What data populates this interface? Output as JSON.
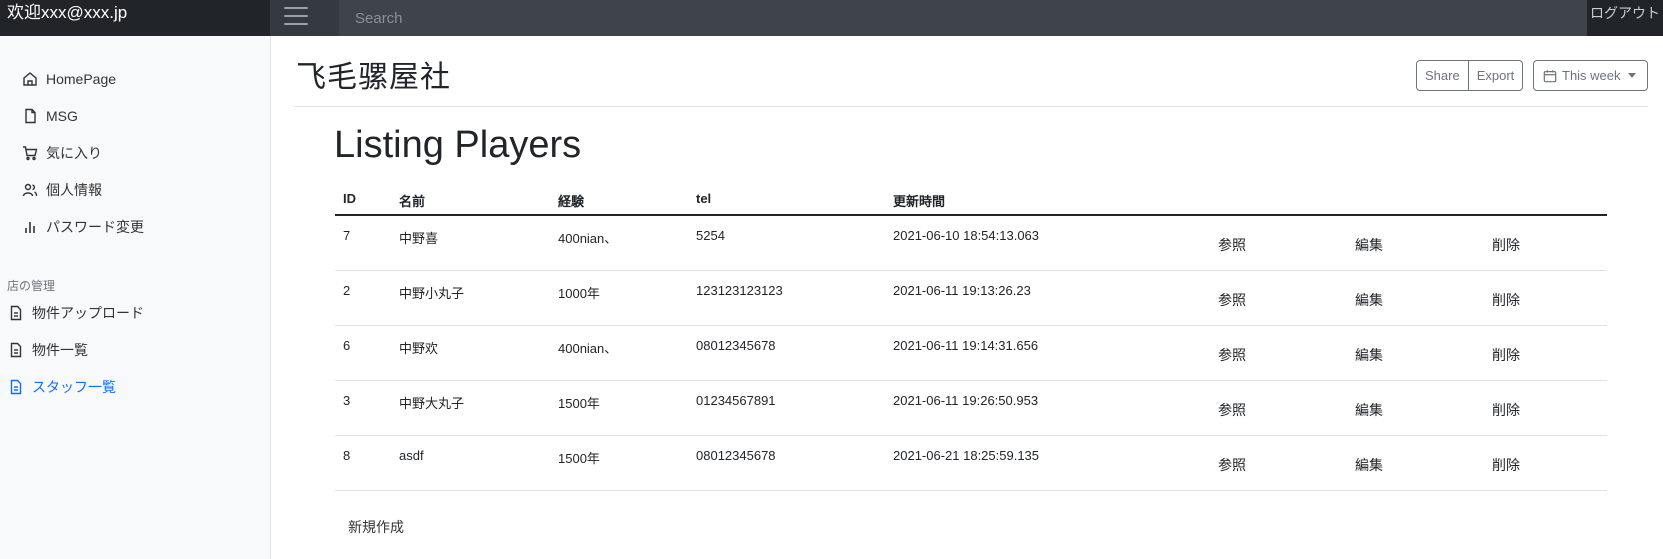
{
  "navbar": {
    "brand": "欢迎xxx@xxx.jp",
    "search_placeholder": "Search",
    "logout_label": "ログアウト"
  },
  "sidebar": {
    "items": [
      {
        "label": "HomePage",
        "icon": "home-icon"
      },
      {
        "label": "MSG",
        "icon": "file-icon"
      },
      {
        "label": "気に入り",
        "icon": "cart-icon"
      },
      {
        "label": "個人情報",
        "icon": "users-icon"
      },
      {
        "label": "パスワード変更",
        "icon": "bar-chart-icon"
      }
    ],
    "section_heading": "店の管理",
    "section_items": [
      {
        "label": "物件アップロード",
        "icon": "file-text-icon",
        "active": false
      },
      {
        "label": "物件一覧",
        "icon": "file-text-icon",
        "active": false
      },
      {
        "label": "スタッフ一覧",
        "icon": "file-text-icon",
        "active": true
      }
    ],
    "active_color": "#0d6efd"
  },
  "header": {
    "title": "飞毛骡屋社",
    "share_label": "Share",
    "export_label": "Export",
    "period_label": "This week",
    "period_icon": "calendar-icon"
  },
  "main": {
    "heading": "Listing Players",
    "columns": [
      "ID",
      "名前",
      "経験",
      "tel",
      "更新時間"
    ],
    "rows": [
      {
        "id": "7",
        "name": "中野喜",
        "exp": "400nian、",
        "tel": "5254",
        "updated": "2021-06-10 18:54:13.063"
      },
      {
        "id": "2",
        "name": "中野小丸子",
        "exp": "1000年",
        "tel": "123123123123",
        "updated": "2021-06-11 19:13:26.23"
      },
      {
        "id": "6",
        "name": "中野欢",
        "exp": "400nian、",
        "tel": "08012345678",
        "updated": "2021-06-11 19:14:31.656"
      },
      {
        "id": "3",
        "name": "中野大丸子",
        "exp": "1500年",
        "tel": "01234567891",
        "updated": "2021-06-11 19:26:50.953"
      },
      {
        "id": "8",
        "name": "asdf",
        "exp": "1500年",
        "tel": "08012345678",
        "updated": "2021-06-21 18:25:59.135"
      }
    ],
    "actions": {
      "view": "参照",
      "edit": "編集",
      "delete": "削除"
    },
    "new_label": "新規作成"
  }
}
